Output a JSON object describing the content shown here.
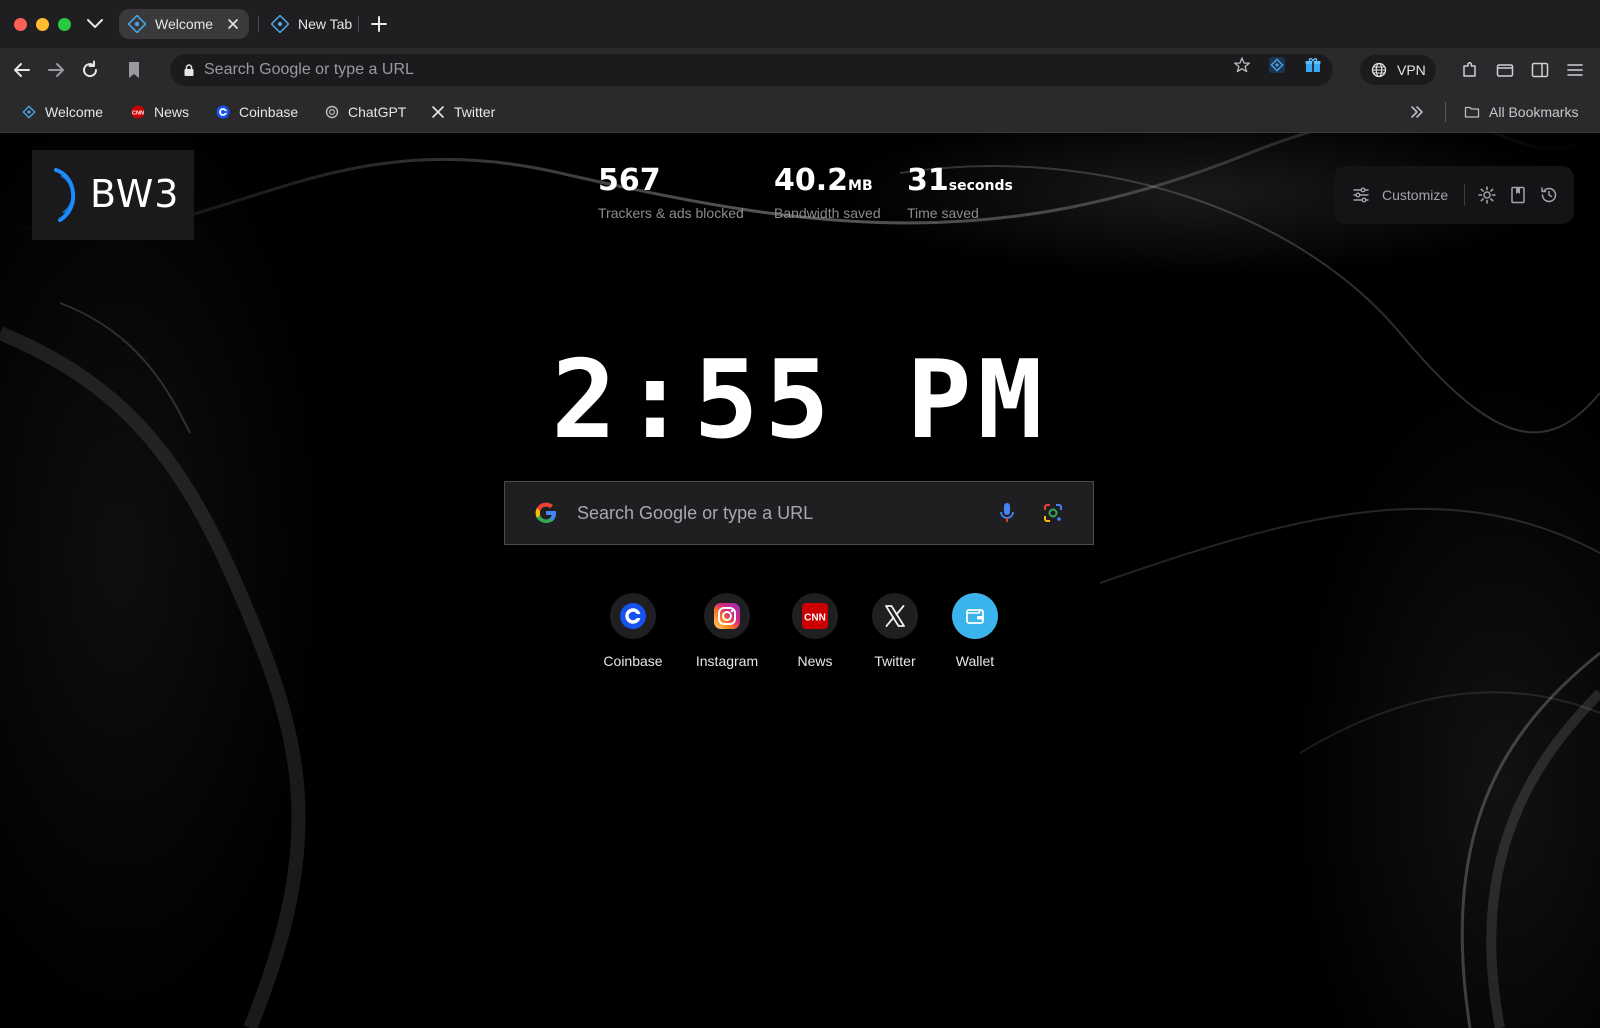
{
  "browser": {
    "tabs": [
      {
        "label": "Welcome",
        "active": true
      },
      {
        "label": "New Tab",
        "active": false
      }
    ],
    "omnibox": {
      "placeholder": "Search Google or type a URL"
    },
    "vpn_label": "VPN",
    "bookmarks": [
      {
        "label": "Welcome",
        "icon": "bw3-icon"
      },
      {
        "label": "News",
        "icon": "cnn-icon"
      },
      {
        "label": "Coinbase",
        "icon": "coinbase-icon"
      },
      {
        "label": "ChatGPT",
        "icon": "chatgpt-icon"
      },
      {
        "label": "Twitter",
        "icon": "x-icon"
      }
    ],
    "all_bookmarks_label": "All Bookmarks"
  },
  "newtab": {
    "logo_text": "BW3",
    "stats": [
      {
        "value": "567",
        "unit": "",
        "label": "Trackers & ads blocked"
      },
      {
        "value": "40.2",
        "unit": "MB",
        "label": "Bandwidth saved"
      },
      {
        "value": "31",
        "unit": "seconds",
        "label": "Time saved"
      }
    ],
    "customize_label": "Customize",
    "clock": "2:55 PM",
    "search": {
      "placeholder": "Search Google or type a URL"
    },
    "shortcuts": [
      {
        "label": "Coinbase",
        "icon": "coinbase-icon"
      },
      {
        "label": "Instagram",
        "icon": "instagram-icon"
      },
      {
        "label": "News",
        "icon": "cnn-icon"
      },
      {
        "label": "Twitter",
        "icon": "x-icon"
      },
      {
        "label": "Wallet",
        "icon": "wallet-icon"
      }
    ]
  },
  "colors": {
    "background": "#000000",
    "tabstrip": "#1f1f21",
    "toolbar": "#2a2a2d",
    "accent_blue": "#1a8cff",
    "coinbase_blue": "#1652f0",
    "cnn_red": "#cc0000",
    "wallet_blue": "#3bb4ee"
  }
}
